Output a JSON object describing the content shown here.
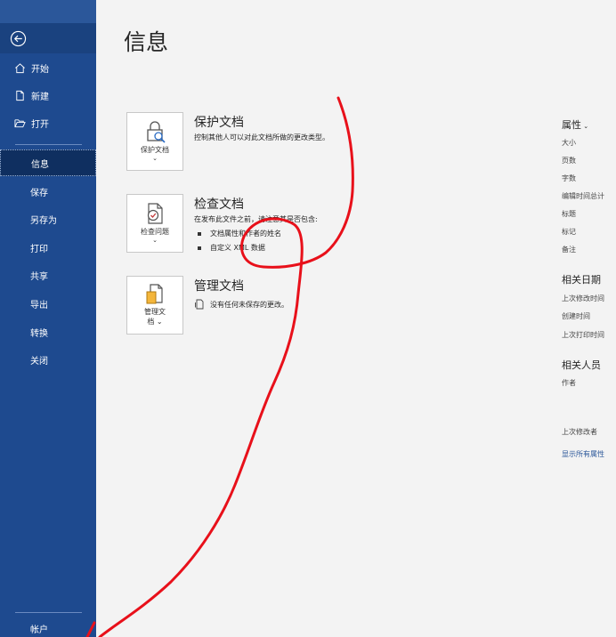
{
  "sidebar": {
    "main_items": [
      {
        "label": "开始",
        "icon": "home-icon"
      },
      {
        "label": "新建",
        "icon": "new-document-icon"
      },
      {
        "label": "打开",
        "icon": "folder-open-icon"
      }
    ],
    "sub_items": [
      {
        "label": "信息",
        "active": true
      },
      {
        "label": "保存"
      },
      {
        "label": "另存为"
      },
      {
        "label": "打印"
      },
      {
        "label": "共享"
      },
      {
        "label": "导出"
      },
      {
        "label": "转换"
      },
      {
        "label": "关闭"
      }
    ],
    "account": "帐户"
  },
  "main": {
    "title": "信息",
    "sections": [
      {
        "tile_label": "保护文档",
        "title": "保护文档",
        "desc": "控制其他人可以对此文档所做的更改类型。"
      },
      {
        "tile_label": "检查问题",
        "title": "检查文档",
        "desc": "在发布此文件之前，请注意其是否包含:",
        "bullets": [
          "文档属性和作者的姓名",
          "自定义 XML 数据"
        ]
      },
      {
        "tile_label_1": "管理文",
        "tile_label_2": "档",
        "title": "管理文档",
        "desc": "没有任何未保存的更改。"
      }
    ]
  },
  "properties": {
    "header": "属性",
    "items": [
      "大小",
      "页数",
      "字数",
      "编辑时间总计",
      "标题",
      "标记",
      "备注"
    ],
    "dates_header": "相关日期",
    "dates": [
      "上次修改时间",
      "创建时间",
      "上次打印时间"
    ],
    "people_header": "相关人员",
    "author": "作者",
    "last_modified_by": "上次修改者",
    "show_all": "显示所有属性"
  },
  "colors": {
    "sidebar": "#1e4a8f",
    "sidebar_active": "#0f2f60",
    "link": "#2b579a",
    "annotation": "#e8101a"
  }
}
